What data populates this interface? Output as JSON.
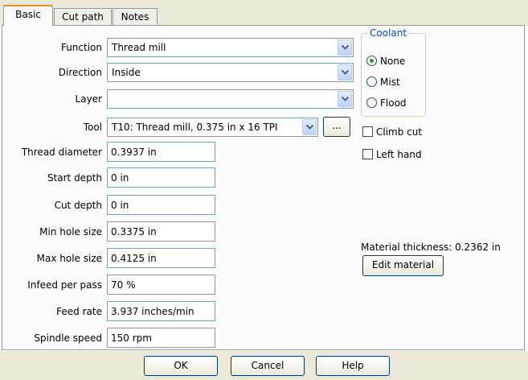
{
  "tabs": [
    {
      "label": "Basic",
      "active": true
    },
    {
      "label": "Cut path",
      "active": false
    },
    {
      "label": "Notes",
      "active": false
    }
  ],
  "function": {
    "label": "Function",
    "value": "Thread mill"
  },
  "direction": {
    "label": "Direction",
    "value": "Inside"
  },
  "layer": {
    "label": "Layer",
    "value": ""
  },
  "tool": {
    "label": "Tool",
    "value": "T10: Thread mill, 0.375 in x 16 TPI",
    "browse_label": "..."
  },
  "fields": [
    {
      "label": "Thread diameter",
      "value": "0.3937 in"
    },
    {
      "label": "Start depth",
      "value": "0 in"
    },
    {
      "label": "Cut depth",
      "value": "0 in"
    },
    {
      "label": "Min hole size",
      "value": "0.3375 in"
    },
    {
      "label": "Max hole size",
      "value": "0.4125 in"
    },
    {
      "label": "Infeed per pass",
      "value": "70 %"
    },
    {
      "label": "Feed rate",
      "value": "3.937 inches/min"
    },
    {
      "label": "Spindle speed",
      "value": "150 rpm"
    }
  ],
  "coolant": {
    "title": "Coolant",
    "options": [
      {
        "label": "None",
        "selected": true
      },
      {
        "label": "Mist",
        "selected": false
      },
      {
        "label": "Flood",
        "selected": false
      }
    ]
  },
  "checks": [
    {
      "label": "Climb cut",
      "checked": false
    },
    {
      "label": "Left hand",
      "checked": false
    }
  ],
  "material": {
    "thickness_text": "Material thickness: 0.2362 in",
    "edit_label": "Edit material"
  },
  "footer": {
    "ok_label": "OK",
    "cancel_label": "Cancel",
    "help_label": "Help"
  },
  "colors": {
    "accent_tab": "#e68b2c",
    "group_title": "#0046d5",
    "radio_dot": "#21a121",
    "footer_bg": "#ece9d8"
  }
}
